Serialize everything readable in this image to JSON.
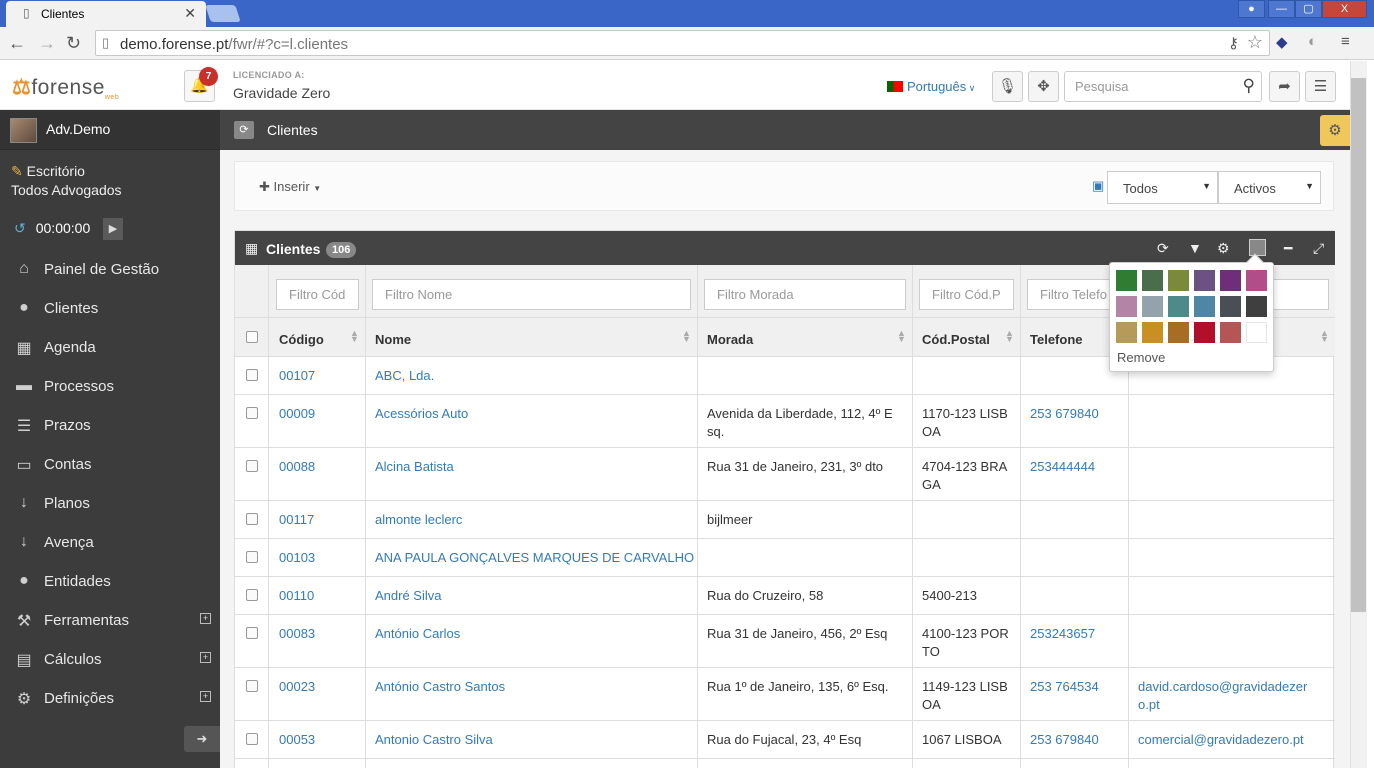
{
  "browser": {
    "tab_title": "Clientes",
    "url_host": "demo.forense.pt",
    "url_path": "/fwr/#?c=l.clientes",
    "win_controls": [
      "—",
      "▢",
      "X"
    ]
  },
  "header": {
    "logo_prefix": "forense",
    "logo_suffix": "web",
    "notifications_count": "7",
    "license_label": "LICENCIADO A:",
    "license_name": "Gravidade Zero",
    "language": "Português",
    "search_placeholder": "Pesquisa"
  },
  "sidebar": {
    "user": "Adv.Demo",
    "office_line1": "Escritório",
    "office_line2": "Todos Advogados",
    "timer": "00:00:00",
    "items": [
      {
        "label": "Painel de Gestão",
        "icon": "home-icon",
        "glyph": "⌂",
        "expandable": false
      },
      {
        "label": "Clientes",
        "icon": "user-icon",
        "glyph": "●",
        "expandable": false
      },
      {
        "label": "Agenda",
        "icon": "calendar-icon",
        "glyph": "▦",
        "expandable": false
      },
      {
        "label": "Processos",
        "icon": "briefcase-icon",
        "glyph": "▬",
        "expandable": false
      },
      {
        "label": "Prazos",
        "icon": "server-icon",
        "glyph": "☰",
        "expandable": false
      },
      {
        "label": "Contas",
        "icon": "money-icon",
        "glyph": "▭",
        "expandable": false
      },
      {
        "label": "Planos",
        "icon": "sort-numeric-icon",
        "glyph": "↓",
        "expandable": false
      },
      {
        "label": "Avença",
        "icon": "sort-alpha-icon",
        "glyph": "↓",
        "expandable": false
      },
      {
        "label": "Entidades",
        "icon": "users-icon",
        "glyph": "●",
        "expandable": false
      },
      {
        "label": "Ferramentas",
        "icon": "wrench-icon",
        "glyph": "⚒",
        "expandable": true
      },
      {
        "label": "Cálculos",
        "icon": "clipboard-icon",
        "glyph": "▤",
        "expandable": true
      },
      {
        "label": "Definições",
        "icon": "cogs-icon",
        "glyph": "⚙",
        "expandable": true
      }
    ]
  },
  "page": {
    "breadcrumb": "Clientes",
    "insert_label": "Inserir",
    "select_scope": "Todos",
    "select_state": "Activos"
  },
  "panel": {
    "title": "Clientes",
    "count": "106",
    "filters": [
      "Filtro Cód",
      "Filtro Nome",
      "Filtro Morada",
      "Filtro Cód.P",
      "Filtro Telefo"
    ],
    "columns": [
      "Código",
      "Nome",
      "Morada",
      "Cód.Postal",
      "Telefone"
    ],
    "rows": [
      {
        "code": "00107",
        "name": "ABC, Lda.",
        "address": "",
        "postal": "",
        "phone": "",
        "email": ""
      },
      {
        "code": "00009",
        "name": "Acessórios Auto",
        "address": "Avenida da Liberdade, 112, 4º E sq.",
        "postal": "1170-123 LISB OA",
        "phone": "253 679840",
        "email": ""
      },
      {
        "code": "00088",
        "name": "Alcina Batista",
        "address": "Rua 31 de Janeiro, 231, 3º dto",
        "postal": "4704-123 BRA GA",
        "phone": "253444444",
        "email": ""
      },
      {
        "code": "00117",
        "name": "almonte leclerc",
        "address": "bijlmeer",
        "postal": "",
        "phone": "",
        "email": ""
      },
      {
        "code": "00103",
        "name": "ANA PAULA GONÇALVES MARQUES DE CARVALHO",
        "address": "",
        "postal": "",
        "phone": "",
        "email": ""
      },
      {
        "code": "00110",
        "name": "André Silva",
        "address": "Rua do Cruzeiro, 58",
        "postal": "5400-213",
        "phone": "",
        "email": ""
      },
      {
        "code": "00083",
        "name": "António Carlos",
        "address": "Rua 31 de Janeiro, 456, 2º Esq",
        "postal": "4100-123 POR TO",
        "phone": "253243657",
        "email": ""
      },
      {
        "code": "00023",
        "name": "António Castro Santos",
        "address": "Rua 1º de Janeiro, 135, 6º Esq.",
        "postal": "1149-123 LISB OA",
        "phone": "253 764534",
        "email": "david.cardoso@gravidadezer o.pt"
      },
      {
        "code": "00053",
        "name": "Antonio Castro Silva",
        "address": "Rua do Fujacal, 23, 4º Esq",
        "postal": "1067 LISBOA",
        "phone": "253 679840",
        "email": "comercial@gravidadezero.pt"
      }
    ]
  },
  "color_picker": {
    "remove_label": "Remove",
    "swatches": [
      "#2e7d32",
      "#4a6e4a",
      "#7a8a3a",
      "#6b5283",
      "#6e2f78",
      "#b24d8a",
      "#b384a6",
      "#94a3ab",
      "#4f8a8a",
      "#4e86a4",
      "#4a4f55",
      "#3f3f3f",
      "#b59a5a",
      "#c98f22",
      "#a86d22",
      "#b0102a",
      "#b55556",
      "#ffffff"
    ]
  },
  "colors": {
    "link": "#337ab7",
    "sidebar_bg": "#3c3c3c",
    "accent": "#f0c75a",
    "badge": "#c9302c"
  }
}
